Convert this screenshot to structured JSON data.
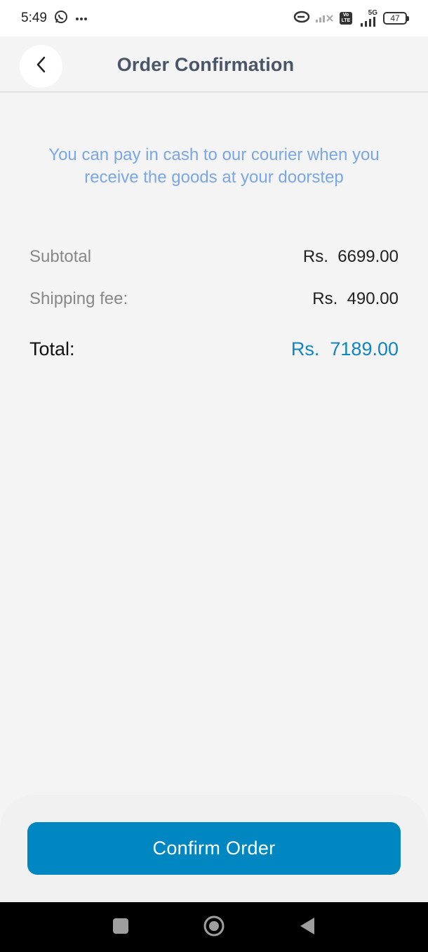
{
  "status_bar": {
    "time": "5:49",
    "net_label": "5G",
    "lte_top": "Vo",
    "lte_bottom": "LTE",
    "battery": "47",
    "icons": [
      "whatsapp-icon",
      "more-dots-icon",
      "link-icon",
      "signal-icon",
      "battery-icon"
    ]
  },
  "header": {
    "title": "Order Confirmation",
    "back_icon": "chevron-left-icon"
  },
  "info_message": "You can pay in cash to our courier when you receive the goods at your doorstep",
  "summary": {
    "subtotal_label": "Subtotal",
    "subtotal_value": "Rs.  6699.00",
    "shipping_label": "Shipping fee:",
    "shipping_value": "Rs.  490.00",
    "total_label": "Total:",
    "total_value": "Rs.  7189.00"
  },
  "actions": {
    "confirm_label": "Confirm Order"
  },
  "nav_bar": {
    "icons": [
      "recent-apps-icon",
      "home-icon",
      "back-icon"
    ]
  },
  "colors": {
    "accent": "#0086c0",
    "info_text": "#7aa7e6",
    "title": "#4a5568",
    "total_value": "#1086bf"
  }
}
